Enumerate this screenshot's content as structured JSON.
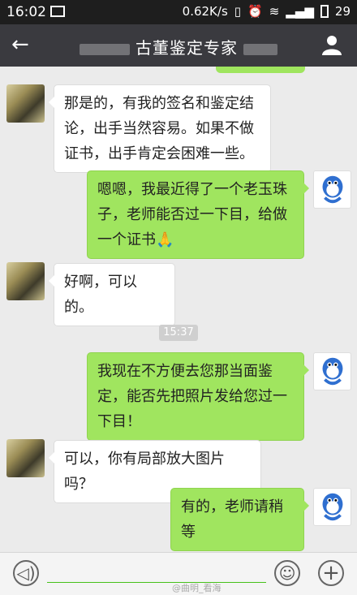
{
  "status_bar": {
    "time": "16:02",
    "speed": "0.62K/s",
    "battery": "29"
  },
  "header": {
    "title": "古董鉴定专家"
  },
  "messages": [
    {
      "side": "in",
      "text": "那是的，有我的签名和鉴定结论，出手当然容易。如果不做证书，出手肯定会困难一些。"
    },
    {
      "side": "out",
      "text": "嗯嗯，我最近得了一个老玉珠子，老师能否过一下目，给做一个证书🙏"
    },
    {
      "side": "in",
      "text": "好啊，可以的。"
    },
    {
      "side": "out",
      "text": "我现在不方便去您那当面鉴定，能否先把照片发给您过一下目！"
    },
    {
      "side": "in",
      "text": "可以，你有局部放大图片吗？"
    },
    {
      "side": "out",
      "text": "有的，老师请稍等"
    }
  ],
  "timestamp": "15:37",
  "watermark": "@曲明_看海",
  "colors": {
    "outgoing_bubble": "#a0e55f",
    "incoming_bubble": "#ffffff",
    "nav_bar": "#3a3a3f",
    "status_bar": "#1e1e1e"
  }
}
